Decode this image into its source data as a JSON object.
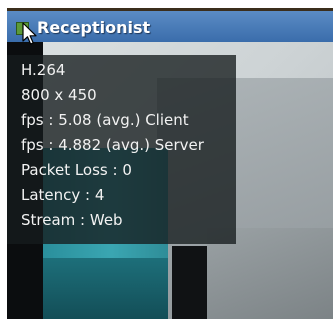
{
  "window": {
    "title": "Receptionist",
    "status_color": "#5c9a39"
  },
  "stats": {
    "codec": "H.264",
    "resolution": "800 x 450",
    "client_fps": "fps : 5.08 (avg.) Client",
    "server_fps": "fps : 4.882 (avg.) Server",
    "packet_loss": "Packet Loss : 0",
    "latency": "Latency : 4",
    "stream": "Stream : Web"
  },
  "icons": {
    "status": "status-indicator-icon",
    "cursor": "mouse-pointer-icon"
  }
}
